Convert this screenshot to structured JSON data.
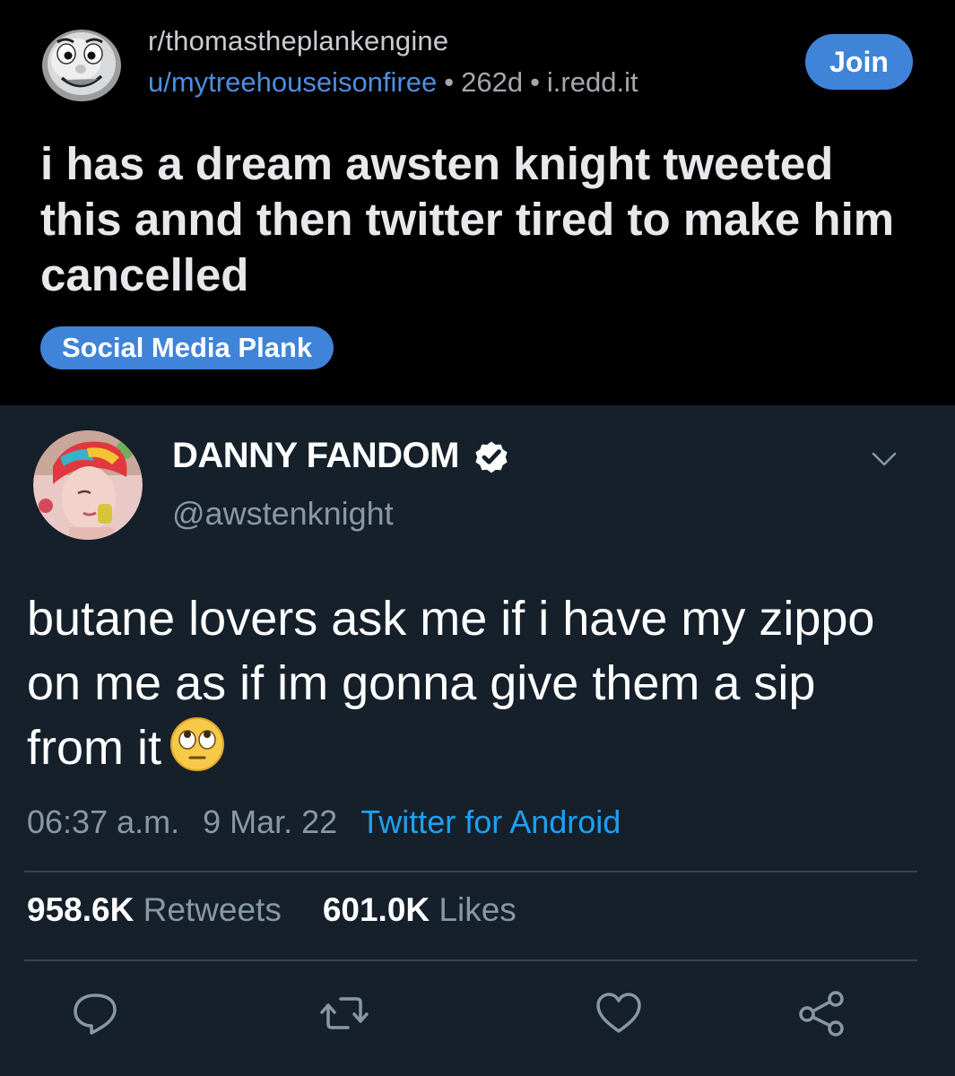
{
  "reddit": {
    "subreddit": "r/thomastheplankengine",
    "author": "u/mytreehouseisonfiree",
    "age": "262d",
    "domain": "i.redd.it",
    "separator": "•",
    "join_label": "Join",
    "title": "i has a dream awsten knight tweeted this annd then twitter tired to make him cancelled",
    "flair": "Social Media Plank",
    "avatar_icon": "thomas-face-icon"
  },
  "tweet": {
    "display_name": "DANNY FANDOM",
    "handle": "@awstenknight",
    "text": "butane lovers ask me if i have my zippo on me as if im gonna give them a sip from it",
    "emoji_icon": "face-with-rolling-eyes-icon",
    "time": "06:37 a.m.",
    "date": "9 Mar. 22",
    "source": "Twitter for Android",
    "retweets_count": "958.6K",
    "retweets_label": "Retweets",
    "likes_count": "601.0K",
    "likes_label": "Likes",
    "colors": {
      "background": "#15202b",
      "link": "#1da1f2",
      "muted": "#8899a6"
    }
  },
  "colors": {
    "reddit_accent": "#3f84d9",
    "reddit_background": "#000000"
  }
}
